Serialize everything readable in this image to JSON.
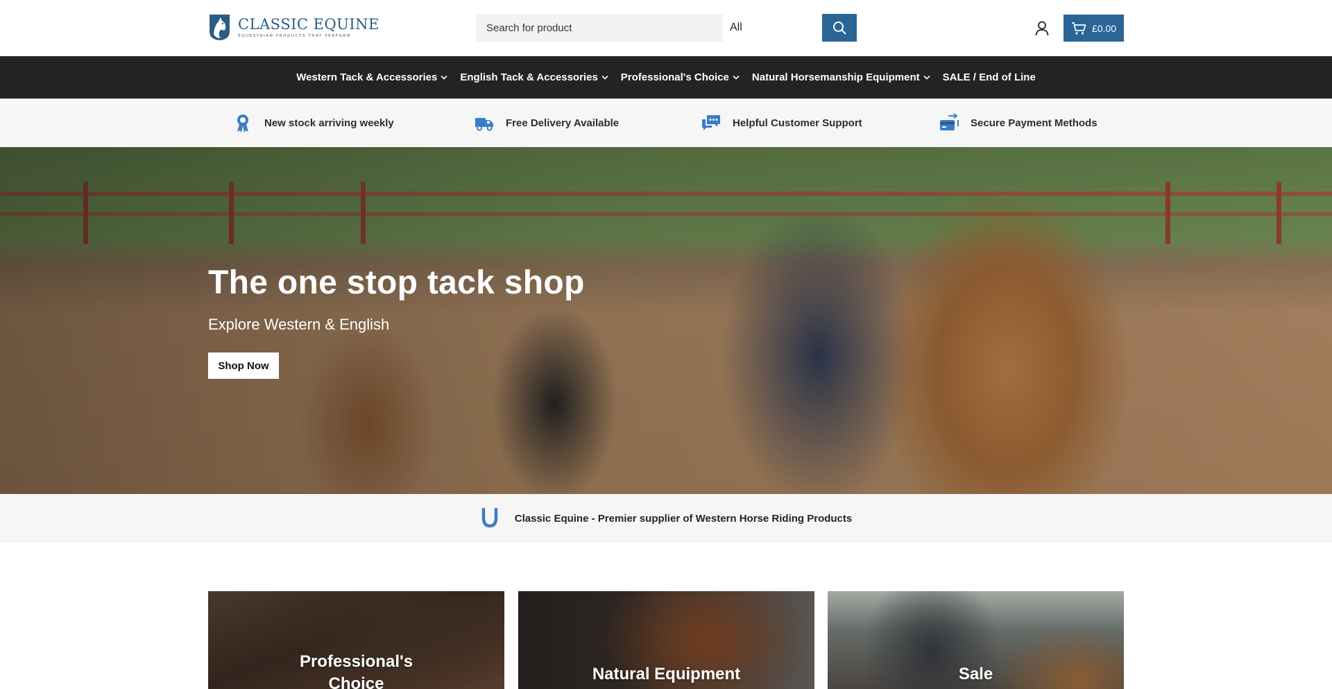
{
  "brand": {
    "name": "CLASSIC EQUINE",
    "tagline": "EQUESTRIAN PRODUCTS THAT PERFORM",
    "accent_color": "#2a6596"
  },
  "search": {
    "placeholder": "Search for product",
    "category": "All",
    "button_icon": "search-icon"
  },
  "header": {
    "account_icon": "user-icon",
    "cart_icon": "cart-icon",
    "cart_total": "£0.00"
  },
  "nav": {
    "items": [
      {
        "label": "Western Tack & Accessories",
        "has_dropdown": true
      },
      {
        "label": "English Tack & Accessories",
        "has_dropdown": true
      },
      {
        "label": "Professional's Choice",
        "has_dropdown": true
      },
      {
        "label": "Natural Horsemanship Equipment",
        "has_dropdown": true
      },
      {
        "label": "SALE / End of Line",
        "has_dropdown": false
      }
    ]
  },
  "features": [
    {
      "icon": "award-ribbon-icon",
      "label": "New stock arriving weekly"
    },
    {
      "icon": "delivery-truck-icon",
      "label": "Free Delivery Available"
    },
    {
      "icon": "chat-support-icon",
      "label": "Helpful Customer Support"
    },
    {
      "icon": "secure-payment-icon",
      "label": "Secure Payment Methods"
    }
  ],
  "hero": {
    "title": "The one stop tack shop",
    "subtitle": "Explore Western & English",
    "button_label": "Shop Now"
  },
  "tagline": {
    "icon": "horseshoe-icon",
    "text": "Classic Equine - Premier supplier of Western Horse Riding Products"
  },
  "categories": [
    {
      "label": "Professional's Choice"
    },
    {
      "label": "Natural Equipment"
    },
    {
      "label": "Sale"
    }
  ]
}
